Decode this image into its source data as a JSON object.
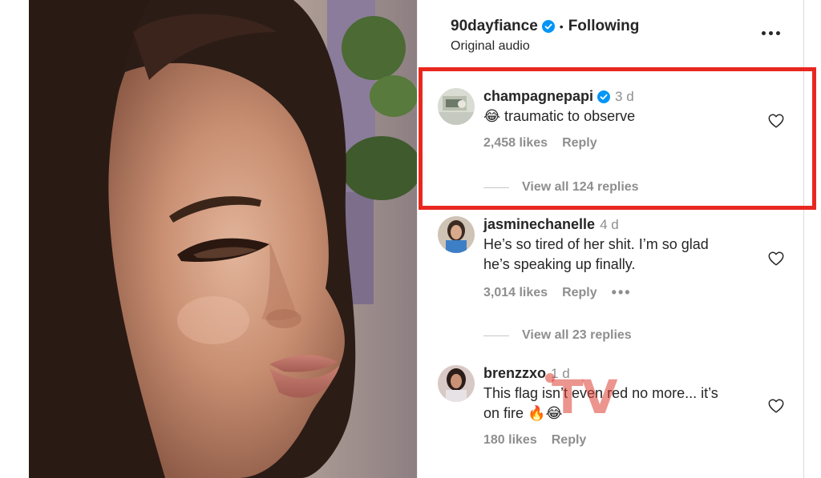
{
  "post": {
    "account": "90dayfiance",
    "separator": "•",
    "follow_status": "Following",
    "audio": "Original audio"
  },
  "comments": [
    {
      "user": "champagnepapi",
      "verified": true,
      "time": "3 d",
      "text": "😂 traumatic to observe",
      "likes": "2,458 likes",
      "reply": "Reply",
      "view_replies": "View all 124 replies",
      "highlighted": true
    },
    {
      "user": "jasminechanelle",
      "verified": false,
      "time": "4 d",
      "text_line1": "He’s so tired of her shit. I’m so glad",
      "text_line2": "he’s speaking up finally.",
      "likes": "3,014 likes",
      "reply": "Reply",
      "more": "•••",
      "view_replies": "View all 23 replies"
    },
    {
      "user": "brenzzxo",
      "verified": false,
      "time": "1 d",
      "text_line1": "This flag isn’t even red no more... it’s",
      "text_line2": "on fire 🔥😂",
      "likes": "180 likes",
      "reply": "Reply"
    }
  ],
  "watermark": "TV",
  "colors": {
    "highlight_border": "#e8281f",
    "verified_blue": "#0095f6",
    "muted_text": "#8e8e8e"
  },
  "icons": {
    "verified": "verified-badge-icon",
    "like": "heart-outline-icon",
    "more": "more-options-icon"
  }
}
